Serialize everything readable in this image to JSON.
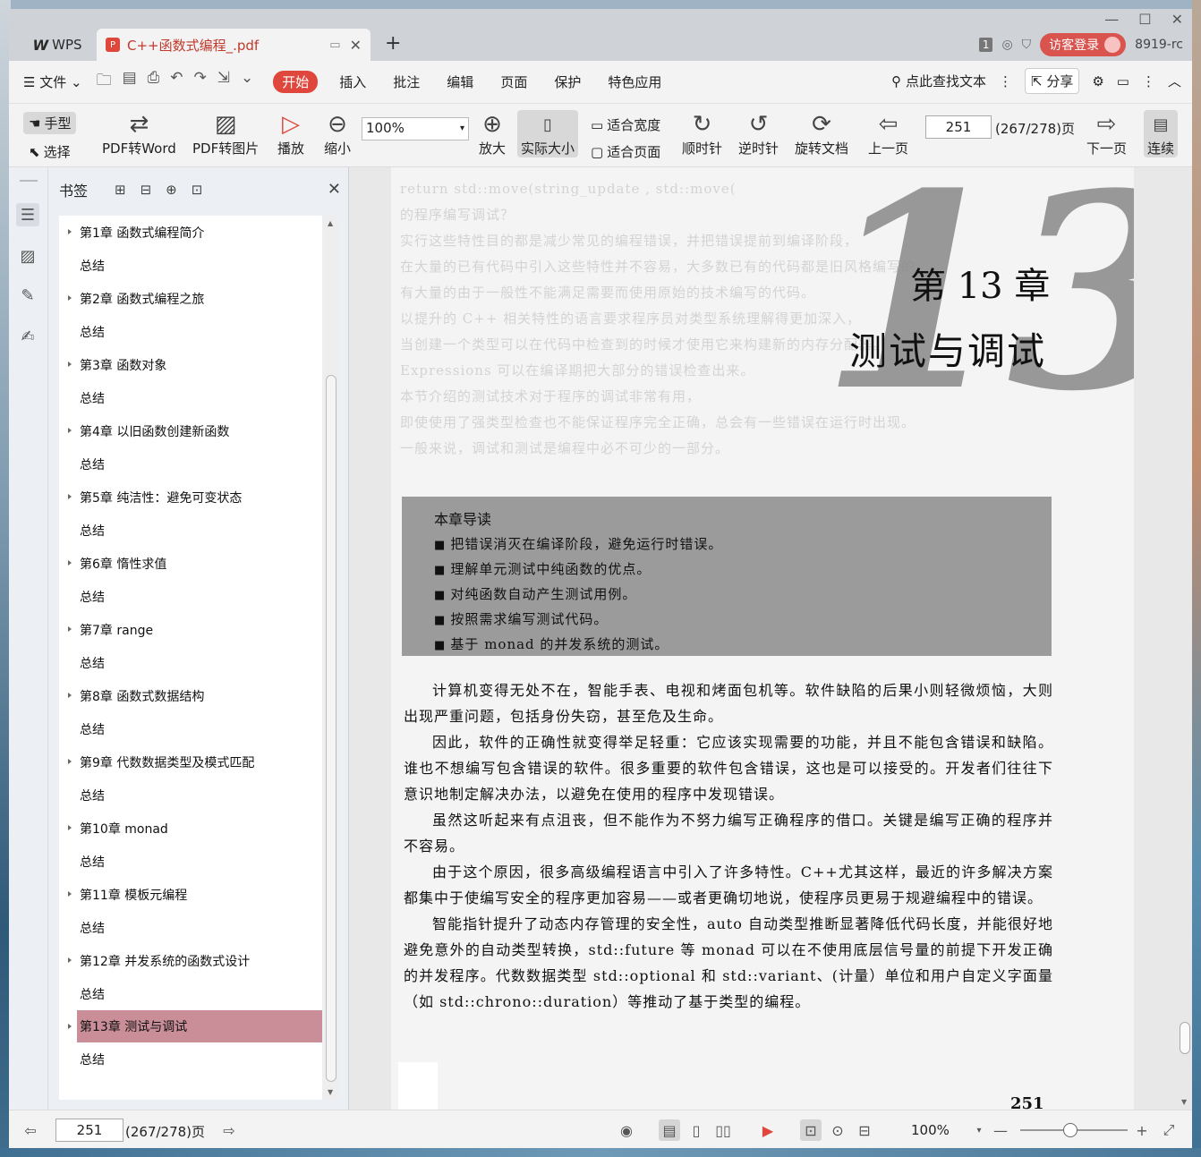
{
  "titlebar": {
    "app_tab": "WPS",
    "doc_tab": "C++函数式编程_.pdf",
    "page_badge": "1",
    "login_label": "访客登录",
    "user_id": "8919-rc"
  },
  "menubar": {
    "file_label": "文件",
    "items": [
      "开始",
      "插入",
      "批注",
      "编辑",
      "页面",
      "保护",
      "特色应用"
    ],
    "search_label": "点此查找文本",
    "share_label": "分享"
  },
  "ribbon": {
    "hand": "手型",
    "select": "选择",
    "pdf_to_word": "PDF转Word",
    "pdf_to_image": "PDF转图片",
    "play": "播放",
    "zoom_out": "缩小",
    "zoom_value": "100%",
    "zoom_in": "放大",
    "actual_size": "实际大小",
    "fit_width": "适合宽度",
    "fit_page": "适合页面",
    "rotate_cw": "顺时针",
    "rotate_ccw": "逆时针",
    "rotate_doc": "旋转文档",
    "prev_page": "上一页",
    "page_input": "251",
    "page_total": "(267/278)页",
    "next_page": "下一页",
    "continuous": "连续"
  },
  "bookmarks": {
    "title": "书签",
    "items": [
      {
        "label": "第1章 函数式编程简介",
        "type": "chapter"
      },
      {
        "label": "总结",
        "type": "sub"
      },
      {
        "label": "第2章 函数式编程之旅",
        "type": "chapter"
      },
      {
        "label": "总结",
        "type": "sub"
      },
      {
        "label": "第3章 函数对象",
        "type": "chapter"
      },
      {
        "label": "总结",
        "type": "sub"
      },
      {
        "label": "第4章 以旧函数创建新函数",
        "type": "chapter"
      },
      {
        "label": "总结",
        "type": "sub"
      },
      {
        "label": "第5章 纯洁性：避免可变状态",
        "type": "chapter"
      },
      {
        "label": "总结",
        "type": "sub"
      },
      {
        "label": "第6章 惰性求值",
        "type": "chapter"
      },
      {
        "label": "总结",
        "type": "sub"
      },
      {
        "label": "第7章 range",
        "type": "chapter"
      },
      {
        "label": "总结",
        "type": "sub"
      },
      {
        "label": "第8章 函数式数据结构",
        "type": "chapter"
      },
      {
        "label": "总结",
        "type": "sub"
      },
      {
        "label": "第9章 代数数据类型及模式匹配",
        "type": "chapter"
      },
      {
        "label": "总结",
        "type": "sub"
      },
      {
        "label": "第10章 monad",
        "type": "chapter"
      },
      {
        "label": "总结",
        "type": "sub"
      },
      {
        "label": "第11章 模板元编程",
        "type": "chapter"
      },
      {
        "label": "总结",
        "type": "sub"
      },
      {
        "label": "第12章 并发系统的函数式设计",
        "type": "chapter"
      },
      {
        "label": "总结",
        "type": "sub"
      },
      {
        "label": "第13章 测试与调试",
        "type": "chapter",
        "selected": true
      },
      {
        "label": "总结",
        "type": "sub"
      }
    ]
  },
  "page": {
    "big_number": "13",
    "chapter_heading": "第 13 章",
    "chapter_title": "测试与调试",
    "guide_title": "本章导读",
    "guide_items": [
      "把错误消灭在编译阶段，避免运行时错误。",
      "理解单元测试中纯函数的优点。",
      "对纯函数自动产生测试用例。",
      "按照需求编写测试代码。",
      "基于 monad 的并发系统的测试。"
    ],
    "paragraphs": [
      "计算机变得无处不在，智能手表、电视和烤面包机等。软件缺陷的后果小则轻微烦恼，大则出现严重问题，包括身份失窃，甚至危及生命。",
      "因此，软件的正确性就变得举足轻重：它应该实现需要的功能，并且不能包含错误和缺陷。谁也不想编写包含错误的软件。很多重要的软件包含错误，这也是可以接受的。开发者们往往下意识地制定解决办法，以避免在使用的程序中发现错误。",
      "虽然这听起来有点沮丧，但不能作为不努力编写正确程序的借口。关键是编写正确的程序并不容易。",
      "由于这个原因，很多高级编程语言中引入了许多特性。C++尤其这样，最近的许多解决方案都集中于使编写安全的程序更加容易——或者更确切地说，使程序员更易于规避编程中的错误。",
      "智能指针提升了动态内存管理的安全性，auto 自动类型推断显著降低代码长度，并能很好地避免意外的自动类型转换，std::future 等 monad 可以在不使用底层信号量的前提下开发正确的并发程序。代数数据类型 std::optional 和 std::variant、(计量）单位和用户自定义字面量（如 std::chrono::duration）等推动了基于类型的编程。"
    ],
    "page_number": "251",
    "bg_lines": [
      "return std::move(string_update , std::move(",
      "的程序编写调试？",
      "实行这些特性目的都是减少常见的编程错误，并把错误提前到编译阶段，",
      "在大量的已有代码中引入这些特性并不容易，大多数已有的代码都是旧风格编写的，",
      "有大量的由于一般性不能满足需要而使用原始的技术编写的代码。",
      "以提升的 C++ 相关特性的语言要求程序员对类型系统理解得更加深入，",
      "当创建一个类型可以在代码中检查到的时候才使用它来构建新的内存分配器。",
      "Expressions 可以在编译期把大部分的错误检查出来。",
      "本节介绍的测试技术对于程序的调试非常有用，",
      "即使使用了强类型检查也不能保证程序完全正确，总会有一些错误在运行时出现。",
      "一般来说，调试和测试是编程中必不可少的一部分。"
    ]
  },
  "statusbar": {
    "page_input": "251",
    "page_total": "(267/278)页",
    "zoom": "100%"
  }
}
